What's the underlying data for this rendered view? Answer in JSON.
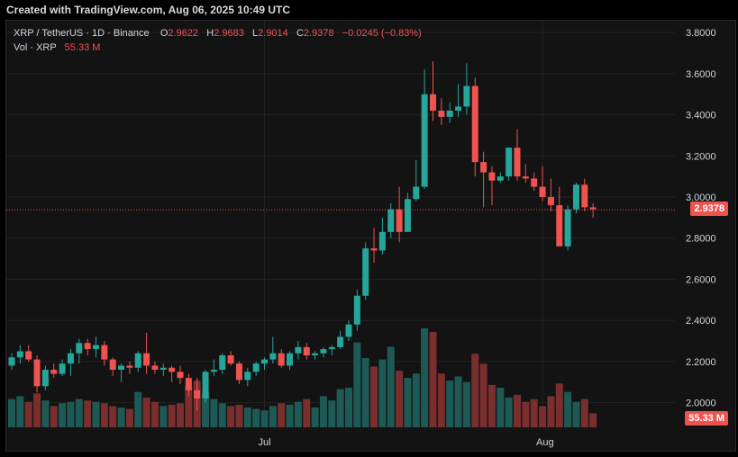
{
  "header": {
    "text": "Created with TradingView.com, Aug 06, 2025 10:49 UTC"
  },
  "legend": {
    "symbol": "XRP / TetherUS · 1D · Binance",
    "o_label": "O",
    "o_value": "2.9622",
    "h_label": "H",
    "h_value": "2.9683",
    "l_label": "L",
    "l_value": "2.9014",
    "c_label": "C",
    "c_value": "2.9378",
    "change": "−0.0245 (−0.83%)",
    "vol_label": "Vol · XRP",
    "vol_value": "55.33 M"
  },
  "price_tag": "2.9378",
  "vol_tag": "55.33 M",
  "colors": {
    "up": "#26a69a",
    "down": "#ef5350",
    "vol_up": "#1e5a55",
    "vol_down": "#7a2e2e"
  },
  "chart_data": {
    "type": "candlestick",
    "y_ticks": [
      "3.8000",
      "3.6000",
      "3.4000",
      "3.2000",
      "3.0000",
      "2.8000",
      "2.6000",
      "2.4000",
      "2.2000",
      "2.0000"
    ],
    "x_ticks": [
      "Jul",
      "Aug"
    ],
    "ylim": [
      1.88,
      3.84
    ],
    "last_price": 2.9378,
    "candles": [
      [
        2.18,
        2.24,
        2.16,
        2.22,
        40
      ],
      [
        2.22,
        2.28,
        2.19,
        2.25,
        44
      ],
      [
        2.25,
        2.28,
        2.2,
        2.21,
        36
      ],
      [
        2.21,
        2.23,
        2.05,
        2.08,
        48
      ],
      [
        2.08,
        2.18,
        2.06,
        2.16,
        38
      ],
      [
        2.16,
        2.19,
        2.12,
        2.14,
        30
      ],
      [
        2.14,
        2.21,
        2.13,
        2.19,
        34
      ],
      [
        2.19,
        2.26,
        2.13,
        2.24,
        36
      ],
      [
        2.24,
        2.31,
        2.19,
        2.29,
        40
      ],
      [
        2.29,
        2.31,
        2.23,
        2.26,
        38
      ],
      [
        2.26,
        2.32,
        2.22,
        2.28,
        36
      ],
      [
        2.28,
        2.3,
        2.18,
        2.21,
        34
      ],
      [
        2.21,
        2.22,
        2.13,
        2.16,
        30
      ],
      [
        2.16,
        2.19,
        2.1,
        2.18,
        28
      ],
      [
        2.18,
        2.2,
        2.14,
        2.17,
        26
      ],
      [
        2.17,
        2.25,
        2.15,
        2.24,
        50
      ],
      [
        2.24,
        2.34,
        2.14,
        2.18,
        42
      ],
      [
        2.18,
        2.2,
        2.14,
        2.16,
        36
      ],
      [
        2.16,
        2.19,
        2.13,
        2.17,
        30
      ],
      [
        2.17,
        2.18,
        2.1,
        2.15,
        32
      ],
      [
        2.15,
        2.18,
        2.09,
        2.12,
        34
      ],
      [
        2.12,
        2.14,
        2.03,
        2.06,
        58
      ],
      [
        2.06,
        2.12,
        1.96,
        2.02,
        66
      ],
      [
        2.02,
        2.16,
        2.0,
        2.15,
        50
      ],
      [
        2.15,
        2.21,
        2.13,
        2.16,
        40
      ],
      [
        2.16,
        2.24,
        2.14,
        2.23,
        34
      ],
      [
        2.23,
        2.25,
        2.18,
        2.19,
        30
      ],
      [
        2.19,
        2.2,
        2.09,
        2.11,
        32
      ],
      [
        2.11,
        2.17,
        2.08,
        2.15,
        28
      ],
      [
        2.15,
        2.2,
        2.13,
        2.19,
        26
      ],
      [
        2.19,
        2.22,
        2.16,
        2.21,
        24
      ],
      [
        2.21,
        2.32,
        2.19,
        2.24,
        30
      ],
      [
        2.24,
        2.26,
        2.17,
        2.18,
        34
      ],
      [
        2.18,
        2.25,
        2.16,
        2.24,
        32
      ],
      [
        2.24,
        2.3,
        2.21,
        2.27,
        36
      ],
      [
        2.27,
        2.29,
        2.21,
        2.23,
        40
      ],
      [
        2.23,
        2.25,
        2.21,
        2.24,
        28
      ],
      [
        2.24,
        2.27,
        2.22,
        2.26,
        44
      ],
      [
        2.26,
        2.28,
        2.23,
        2.27,
        38
      ],
      [
        2.27,
        2.35,
        2.26,
        2.32,
        54
      ],
      [
        2.32,
        2.4,
        2.3,
        2.38,
        56
      ],
      [
        2.38,
        2.55,
        2.35,
        2.52,
        120
      ],
      [
        2.52,
        2.78,
        2.5,
        2.75,
        98
      ],
      [
        2.75,
        2.85,
        2.68,
        2.74,
        86
      ],
      [
        2.74,
        2.9,
        2.72,
        2.83,
        96
      ],
      [
        2.83,
        2.97,
        2.8,
        2.94,
        114
      ],
      [
        2.94,
        3.05,
        2.78,
        2.83,
        80
      ],
      [
        2.83,
        3.02,
        2.85,
        2.99,
        70
      ],
      [
        2.99,
        3.18,
        2.98,
        3.05,
        76
      ],
      [
        3.05,
        3.62,
        3.04,
        3.5,
        140
      ],
      [
        3.5,
        3.66,
        3.37,
        3.42,
        135
      ],
      [
        3.42,
        3.48,
        3.35,
        3.39,
        76
      ],
      [
        3.39,
        3.46,
        3.36,
        3.42,
        66
      ],
      [
        3.42,
        3.55,
        3.39,
        3.44,
        72
      ],
      [
        3.44,
        3.65,
        3.4,
        3.54,
        64
      ],
      [
        3.54,
        3.58,
        3.1,
        3.17,
        104
      ],
      [
        3.17,
        3.22,
        2.95,
        3.12,
        90
      ],
      [
        3.12,
        3.15,
        2.96,
        3.08,
        60
      ],
      [
        3.08,
        3.12,
        3.07,
        3.1,
        56
      ],
      [
        3.1,
        3.24,
        3.08,
        3.24,
        42
      ],
      [
        3.24,
        3.33,
        3.08,
        3.1,
        46
      ],
      [
        3.1,
        3.16,
        3.07,
        3.09,
        36
      ],
      [
        3.09,
        3.12,
        3.03,
        3.05,
        40
      ],
      [
        3.05,
        3.15,
        2.98,
        3.0,
        30
      ],
      [
        3.0,
        3.09,
        2.93,
        2.96,
        44
      ],
      [
        2.96,
        3.05,
        2.78,
        2.76,
        62
      ],
      [
        2.76,
        2.96,
        2.74,
        2.94,
        50
      ],
      [
        2.94,
        3.07,
        2.92,
        3.06,
        36
      ],
      [
        3.06,
        3.09,
        2.93,
        2.95,
        40
      ],
      [
        2.95,
        2.97,
        2.9,
        2.94,
        20
      ]
    ]
  }
}
